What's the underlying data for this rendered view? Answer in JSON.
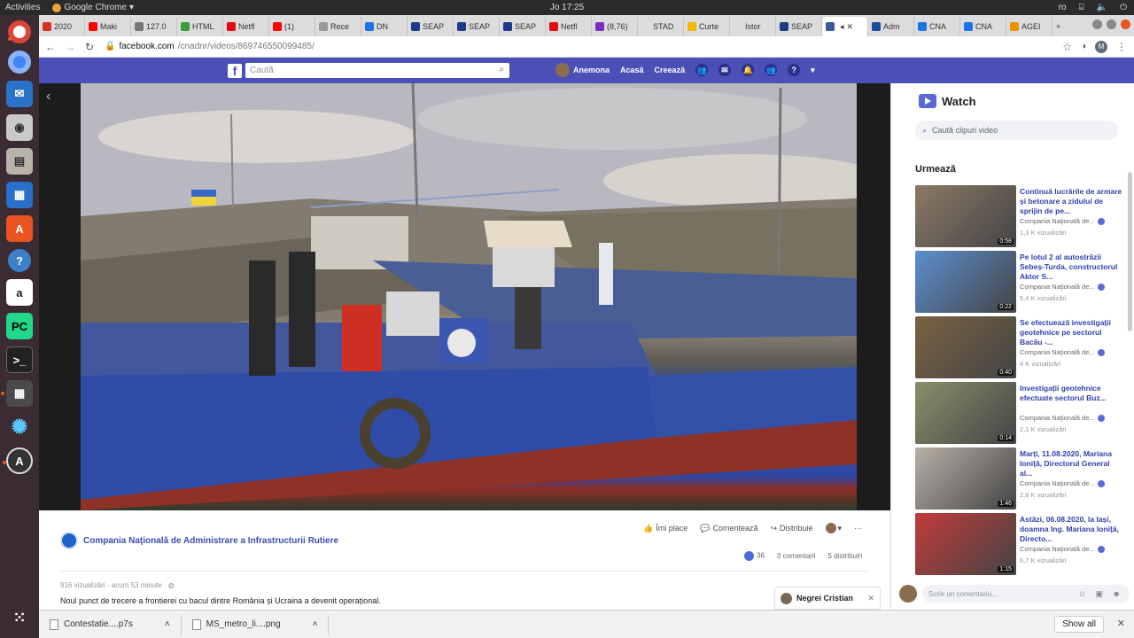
{
  "system": {
    "activities": "Activities",
    "app": "Google Chrome",
    "clock": "Jo 17:25",
    "lang": "ro"
  },
  "tabs": [
    {
      "label": "2020",
      "color": "#d93025"
    },
    {
      "label": "Maki",
      "color": "#ff0000"
    },
    {
      "label": "127.0",
      "color": "#777777"
    },
    {
      "label": "HTML",
      "color": "#3c9b3c"
    },
    {
      "label": "Netfl",
      "color": "#e50914"
    },
    {
      "label": "(1)",
      "color": "#ff0000"
    },
    {
      "label": "Rece",
      "color": "#999999"
    },
    {
      "label": "DN",
      "color": "#1a73e8"
    },
    {
      "label": "SEAP",
      "color": "#1b3a8a"
    },
    {
      "label": "SEAP",
      "color": "#1b3a8a"
    },
    {
      "label": "SEAP",
      "color": "#1b3a8a"
    },
    {
      "label": "Netfl",
      "color": "#e50914"
    },
    {
      "label": "(8,76)",
      "color": "#7b2fbe"
    },
    {
      "label": "STAD",
      "color": "#dddddd"
    },
    {
      "label": "Curte",
      "color": "#f4b400"
    },
    {
      "label": "Istor",
      "color": "#dddddd"
    },
    {
      "label": "SEAP",
      "color": "#1b3a8a"
    },
    {
      "label": "",
      "color": "#3b5998",
      "active": true
    },
    {
      "label": "Adm",
      "color": "#1a4a9a"
    },
    {
      "label": "CNA",
      "color": "#1a73e8"
    },
    {
      "label": "CNA",
      "color": "#1a73e8"
    },
    {
      "label": "AGEI",
      "color": "#e69500"
    }
  ],
  "address": {
    "host": "facebook.com",
    "path": "/cnadnr/videos/869746550099485/",
    "profile_letter": "M"
  },
  "fb": {
    "search_placeholder": "Caută",
    "user": "Anemona",
    "home": "Acasă",
    "create": "Creează"
  },
  "post": {
    "page_name": "Compania Naţională de Administrare a Infrastructurii Rutiere",
    "like": "Îmi place",
    "comment": "Comentează",
    "share": "Distribuie",
    "reactions": "36",
    "comments": "3 comentarii",
    "shares": "5 distribuiri",
    "meta": "916 vizualizări · acum 53 minute ·",
    "description": "Noul punct de trecere a frontierei cu bacul dintre România și Ucraina a devenit operațional.",
    "chat_name": "Negrei Cristian"
  },
  "watch": {
    "title": "Watch",
    "search_placeholder": "Caută clipuri video",
    "next_label": "Urmează",
    "comment_placeholder": "Scrie un comentariu...",
    "videos": [
      {
        "title": "Continuă lucrările de armare și betonare a zidului de sprijin de pe...",
        "channel": "Compania Naţională de...",
        "views": "1,3 K vizualizări",
        "duration": "0:58",
        "color": "#8c7a66"
      },
      {
        "title": "Pe lotul 2 al autostrăzii Sebeș-Turda, constructorul Aktor S...",
        "channel": "Compania Naţională de...",
        "views": "5,4 K vizualizări",
        "duration": "0:22",
        "color": "#5c8fd0"
      },
      {
        "title": "Se efectuează investigații geotehnice pe sectorul Bacău -...",
        "channel": "Compania Naţională de...",
        "views": "4 K vizualizări",
        "duration": "0:40",
        "color": "#7a6242"
      },
      {
        "title": "Investigații geotehnice efectuate sectorul Buz...",
        "channel": "Compania Naţională de...",
        "views": "2,1 K vizualizări",
        "duration": "0:14",
        "color": "#8a8f6a"
      },
      {
        "title": "Marți, 11.08.2020, Mariana Ioniță, Directorul General al...",
        "channel": "Compania Naţională de...",
        "views": "2,8 K vizualizări",
        "duration": "1:46",
        "color": "#b8b0a8"
      },
      {
        "title": "Astăzi, 06.08.2020, la Iași, doamna Ing. Mariana Ioniță, Directo...",
        "channel": "Compania Naţională de...",
        "views": "6,7 K vizualizări",
        "duration": "1:15",
        "color": "#c23b3b"
      }
    ]
  },
  "downloads": {
    "items": [
      "Contestatie....p7s",
      "MS_metro_li....png"
    ],
    "show_all": "Show all"
  }
}
